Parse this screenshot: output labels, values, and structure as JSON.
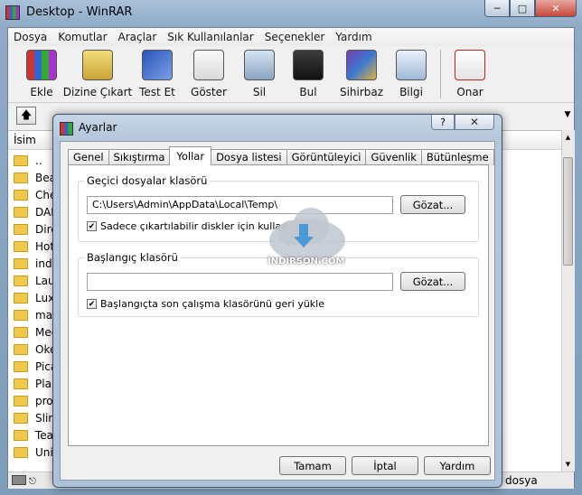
{
  "window": {
    "title": "Desktop - WinRAR"
  },
  "menu": [
    "Dosya",
    "Komutlar",
    "Araçlar",
    "Sık Kullanılanlar",
    "Seçenekler",
    "Yardım"
  ],
  "toolbar": {
    "add": "Ekle",
    "extract": "Dizine Çıkart",
    "test": "Test Et",
    "view": "Göster",
    "delete": "Sil",
    "find": "Bul",
    "wizard": "Sihirbaz",
    "info": "Bilgi",
    "repair": "Onar"
  },
  "filelist": {
    "column_name": "İsim",
    "rows": [
      "..",
      "Bear",
      "Chea",
      "DAEI",
      "Direc",
      "Hots",
      "indir",
      "Laur",
      "Luxo",
      "mac",
      "Med",
      "Okey",
      "Picas",
      "Plan",
      "prog",
      "Slim",
      "Tear",
      "Unity"
    ]
  },
  "statusbar": {
    "text": "dosya"
  },
  "dialog": {
    "title": "Ayarlar",
    "help": "?",
    "tabs": [
      "Genel",
      "Sıkıştırma",
      "Yollar",
      "Dosya listesi",
      "Görüntüleyici",
      "Güvenlik",
      "Bütünleşme"
    ],
    "active_tab": "Yollar",
    "temp_group": {
      "legend": "Geçici dosyalar klasörü",
      "path": "C:\\Users\\Admin\\AppData\\Local\\Temp\\",
      "browse": "Gözat...",
      "checkbox": "Sadece çıkartılabilir diskler için kullan",
      "checked": true
    },
    "start_group": {
      "legend": "Başlangıç klasörü",
      "path": "",
      "browse": "Gözat...",
      "checkbox": "Başlangıçta son çalışma klasörünü geri yükle",
      "checked": true
    },
    "buttons": {
      "ok": "Tamam",
      "cancel": "İptal",
      "help": "Yardım"
    }
  },
  "watermark": {
    "text": "İNDİRSON.COM"
  }
}
